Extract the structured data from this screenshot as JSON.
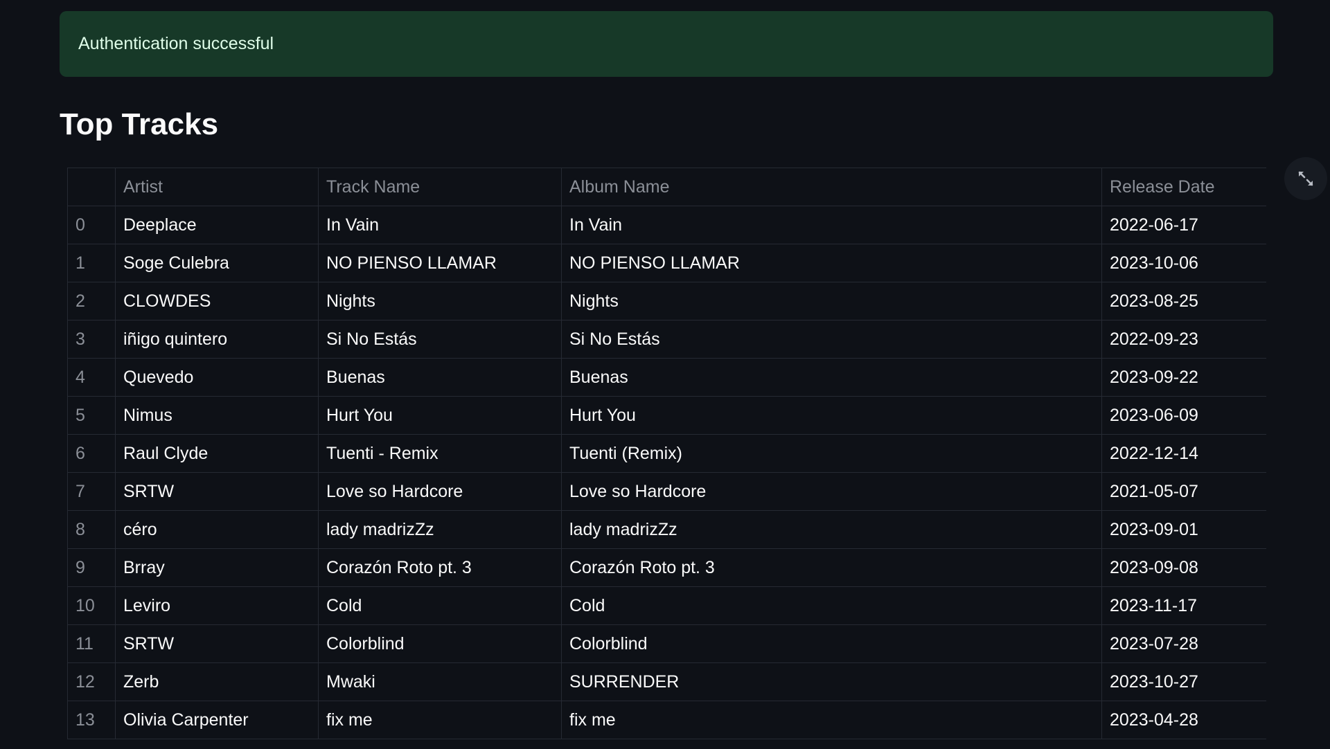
{
  "alert": {
    "message": "Authentication successful",
    "color": "#173928"
  },
  "page": {
    "title": "Top Tracks"
  },
  "table": {
    "columns": [
      "",
      "Artist",
      "Track Name",
      "Album Name",
      "Release Date"
    ],
    "rows": [
      {
        "index": "0",
        "artist": "Deeplace",
        "track": "In Vain",
        "album": "In Vain",
        "release": "2022-06-17"
      },
      {
        "index": "1",
        "artist": "Soge Culebra",
        "track": "NO PIENSO LLAMAR",
        "album": "NO PIENSO LLAMAR",
        "release": "2023-10-06"
      },
      {
        "index": "2",
        "artist": "CLOWDES",
        "track": "Nights",
        "album": "Nights",
        "release": "2023-08-25"
      },
      {
        "index": "3",
        "artist": "iñigo quintero",
        "track": "Si No Estás",
        "album": "Si No Estás",
        "release": "2022-09-23"
      },
      {
        "index": "4",
        "artist": "Quevedo",
        "track": "Buenas",
        "album": "Buenas",
        "release": "2023-09-22"
      },
      {
        "index": "5",
        "artist": "Nimus",
        "track": "Hurt You",
        "album": "Hurt You",
        "release": "2023-06-09"
      },
      {
        "index": "6",
        "artist": "Raul Clyde",
        "track": "Tuenti - Remix",
        "album": "Tuenti (Remix)",
        "release": "2022-12-14"
      },
      {
        "index": "7",
        "artist": "SRTW",
        "track": "Love so Hardcore",
        "album": "Love so Hardcore",
        "release": "2021-05-07"
      },
      {
        "index": "8",
        "artist": "céro",
        "track": "lady madrizZz",
        "album": "lady madrizZz",
        "release": "2023-09-01"
      },
      {
        "index": "9",
        "artist": "Brray",
        "track": "Corazón Roto pt. 3",
        "album": "Corazón Roto pt. 3",
        "release": "2023-09-08"
      },
      {
        "index": "10",
        "artist": "Leviro",
        "track": "Cold",
        "album": "Cold",
        "release": "2023-11-17"
      },
      {
        "index": "11",
        "artist": "SRTW",
        "track": "Colorblind",
        "album": "Colorblind",
        "release": "2023-07-28"
      },
      {
        "index": "12",
        "artist": "Zerb",
        "track": "Mwaki",
        "album": "SURRENDER",
        "release": "2023-10-27"
      },
      {
        "index": "13",
        "artist": "Olivia Carpenter",
        "track": "fix me",
        "album": "fix me",
        "release": "2023-04-28"
      }
    ]
  },
  "toolbar": {
    "fullscreen_icon": "expand-icon"
  }
}
